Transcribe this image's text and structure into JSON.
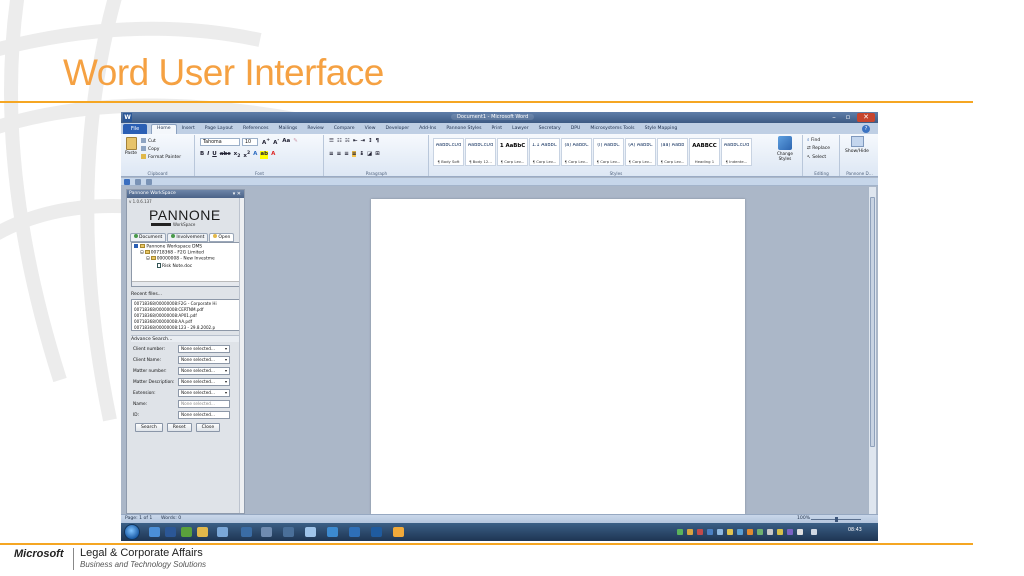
{
  "slide": {
    "title": "Word User Interface",
    "footer_logo": "Microsoft",
    "footer_main": "Legal & Corporate Affairs",
    "footer_sub": "Business and Technology Solutions",
    "accent_color": "#f5a623"
  },
  "window": {
    "title": "Document1 - Microsoft Word",
    "app_icon": "W"
  },
  "ribbon_tabs": {
    "file": "File",
    "tabs": [
      "Home",
      "Insert",
      "Page Layout",
      "References",
      "Mailings",
      "Review",
      "Compare",
      "View",
      "Developer",
      "Add-Ins",
      "Pannone Styles",
      "Print",
      "Lawyer",
      "Secretary",
      "DPU",
      "Microsystems Tools",
      "Style Mapping"
    ],
    "active": "Home"
  },
  "ribbon": {
    "clipboard": {
      "paste": "Paste",
      "cut": "Cut",
      "copy": "Copy",
      "format_painter": "Format Painter",
      "label": "Clipboard"
    },
    "font": {
      "name": "Tahoma",
      "size": "10",
      "label": "Font"
    },
    "paragraph": {
      "label": "Paragraph"
    },
    "styles": {
      "label": "Styles",
      "items": [
        {
          "sample": "AaBbCcDd",
          "name": "¶ Body Soft"
        },
        {
          "sample": "AaBbCcDd",
          "name": "¶ Body 12..."
        },
        {
          "sample": "1 AaBbC",
          "name": "¶ Corp Lev..."
        },
        {
          "sample": "1.1 AaBbC",
          "name": "¶ Corp Lev..."
        },
        {
          "sample": "(a) AaBbC",
          "name": "¶ Corp Lev..."
        },
        {
          "sample": "(i) AaBbC",
          "name": "¶ Corp Lev..."
        },
        {
          "sample": "(A) AaBbC",
          "name": "¶ Corp Lev..."
        },
        {
          "sample": "(aa) AaBb",
          "name": "¶ Corp Lev..."
        },
        {
          "sample": "AABBCC",
          "name": "Heading 1"
        },
        {
          "sample": "AaBbCcDd",
          "name": "¶ Indente..."
        }
      ],
      "change_styles": "Change Styles"
    },
    "editing": {
      "find": "Find",
      "replace": "Replace",
      "select": "Select",
      "label": "Editing"
    },
    "pannone": {
      "show_hide": "Show/Hide",
      "label": "Pannone D..."
    }
  },
  "pane": {
    "header": "Pannone WorkSpace",
    "version": "v 1.0.6.137",
    "logo": "PANNONE",
    "logo_sub": "WorkSpace",
    "tabs": [
      "Document",
      "Involvement",
      "Open"
    ],
    "tree": [
      "Pannone Workspace DMS",
      "00718368 - F2G Limited",
      "00000008 - New Investme",
      "Risk Note.doc"
    ],
    "recent_header": "Recent files...",
    "recent": [
      "00718368/00000008:F2G - Corporate Hi",
      "00718368/00000008:CERTNM.pdf",
      "00718368/00000008:AP01.pdf",
      "00718368/00000008:AA.pdf",
      "00718368/00000008:123 - 29.8.2002.p"
    ],
    "advance_header": "Advance Search...",
    "fields": [
      {
        "label": "Client number:",
        "value": "None selected..."
      },
      {
        "label": "Client Name:",
        "value": "None selected..."
      },
      {
        "label": "Matter number:",
        "value": "None selected..."
      },
      {
        "label": "Matter Description:",
        "value": "None selected..."
      },
      {
        "label": "Extension:",
        "value": "None selected..."
      }
    ],
    "name_label": "Name:",
    "name_placeholder": "None selected...",
    "id_label": "ID:",
    "id_value": "None selected...",
    "buttons": {
      "search": "Search",
      "reset": "Reset",
      "close": "Close"
    }
  },
  "status": {
    "page": "Page: 1 of 1",
    "words": "Words: 0",
    "zoom": "100%"
  },
  "taskbar": {
    "clock": "08:43"
  }
}
